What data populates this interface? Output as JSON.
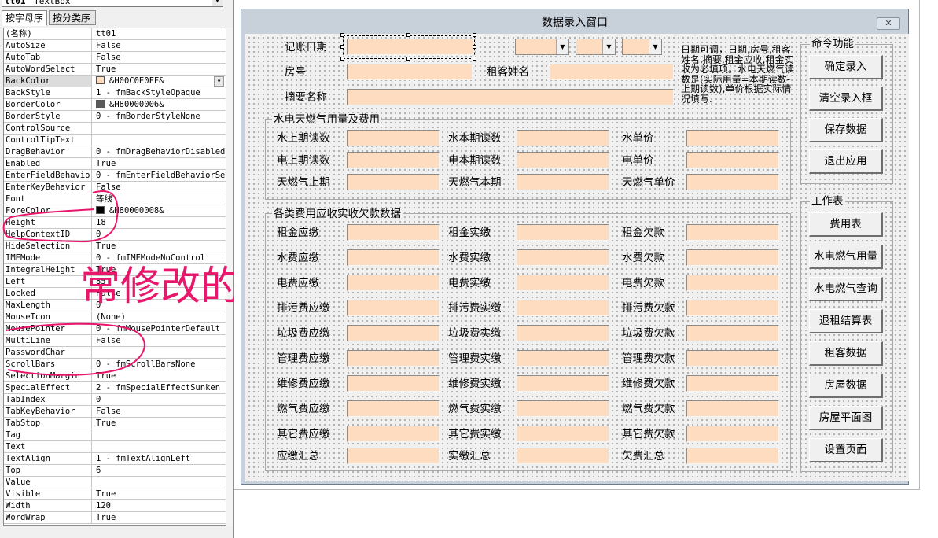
{
  "properties_window": {
    "object_name": "tt01",
    "object_type": "TextBox",
    "tabs": [
      "按字母序",
      "按分类序"
    ],
    "rows": [
      {
        "name": "(名称)",
        "value": "tt01"
      },
      {
        "name": "AutoSize",
        "value": "False"
      },
      {
        "name": "AutoTab",
        "value": "False"
      },
      {
        "name": "AutoWordSelect",
        "value": "True"
      },
      {
        "name": "BackColor",
        "value": "&H00C0E0FF&",
        "swatch": "#fddcc0",
        "selected": true
      },
      {
        "name": "BackStyle",
        "value": "1 - fmBackStyleOpaque"
      },
      {
        "name": "BorderColor",
        "value": "&H80000006&",
        "swatch": "#5a5a5a"
      },
      {
        "name": "BorderStyle",
        "value": "0 - fmBorderStyleNone"
      },
      {
        "name": "ControlSource",
        "value": ""
      },
      {
        "name": "ControlTipText",
        "value": ""
      },
      {
        "name": "DragBehavior",
        "value": "0 - fmDragBehaviorDisabled"
      },
      {
        "name": "Enabled",
        "value": "True"
      },
      {
        "name": "EnterFieldBehavior",
        "value": "0 - fmEnterFieldBehaviorSele"
      },
      {
        "name": "EnterKeyBehavior",
        "value": "False"
      },
      {
        "name": "Font",
        "value": "等线"
      },
      {
        "name": "ForeColor",
        "value": "&H80000008&",
        "swatch": "#000000"
      },
      {
        "name": "Height",
        "value": "18"
      },
      {
        "name": "HelpContextID",
        "value": "0"
      },
      {
        "name": "HideSelection",
        "value": "True"
      },
      {
        "name": "IMEMode",
        "value": "0 - fmIMEModeNoControl"
      },
      {
        "name": "IntegralHeight",
        "value": "True"
      },
      {
        "name": "Left",
        "value": "85"
      },
      {
        "name": "Locked",
        "value": "False"
      },
      {
        "name": "MaxLength",
        "value": "0"
      },
      {
        "name": "MouseIcon",
        "value": "(None)"
      },
      {
        "name": "MousePointer",
        "value": "0 - fmMousePointerDefault"
      },
      {
        "name": "MultiLine",
        "value": "False"
      },
      {
        "name": "PasswordChar",
        "value": ""
      },
      {
        "name": "ScrollBars",
        "value": "0 - fmScrollBarsNone"
      },
      {
        "name": "SelectionMargin",
        "value": "True"
      },
      {
        "name": "SpecialEffect",
        "value": "2 - fmSpecialEffectSunken"
      },
      {
        "name": "TabIndex",
        "value": "0"
      },
      {
        "name": "TabKeyBehavior",
        "value": "False"
      },
      {
        "name": "TabStop",
        "value": "True"
      },
      {
        "name": "Tag",
        "value": ""
      },
      {
        "name": "Text",
        "value": ""
      },
      {
        "name": "TextAlign",
        "value": "1 - fmTextAlignLeft"
      },
      {
        "name": "Top",
        "value": "6"
      },
      {
        "name": "Value",
        "value": ""
      },
      {
        "name": "Visible",
        "value": "True"
      },
      {
        "name": "Width",
        "value": "120"
      },
      {
        "name": "WordWrap",
        "value": "True"
      }
    ]
  },
  "annotation": {
    "text": "常修改的属性",
    "color": "#e8176b"
  },
  "form": {
    "title": "数据录入窗口",
    "close_glyph": "✕",
    "fields": {
      "date_label": "记账日期",
      "room_label": "房号",
      "tenant_label": "租客姓名",
      "summary_label": "摘要名称"
    },
    "note": "日期可调，日期,房号,租客姓名,摘要,租金应收,租金实收为必填项。水电天燃气读数是(实际用量=本期读数-上期读数),单价根据实际情况填写."
  },
  "utility_frame": {
    "title": "水电天燃气用量及费用",
    "rows": [
      [
        "水上期读数",
        "水本期读数",
        "水单价"
      ],
      [
        "电上期读数",
        "电本期读数",
        "电单价"
      ],
      [
        "天燃气上期",
        "天燃气本期",
        "天燃气单价"
      ]
    ]
  },
  "fees_frame": {
    "title": "各类费用应收实收欠款数据",
    "rows": [
      [
        "租金应缴",
        "租金实缴",
        "租金欠款"
      ],
      [
        "水费应缴",
        "水费实缴",
        "水费欠款"
      ],
      [
        "电费应缴",
        "电费实缴",
        "电费欠款"
      ],
      [
        "排污费应缴",
        "排污费实缴",
        "排污费欠款"
      ],
      [
        "垃圾费应缴",
        "垃圾费实缴",
        "垃圾费欠款"
      ],
      [
        "管理费应缴",
        "管理费实缴",
        "管理费欠款"
      ],
      [
        "维修费应缴",
        "维修费实缴",
        "维修费欠款"
      ],
      [
        "燃气费应缴",
        "燃气费实缴",
        "燃气费欠款"
      ],
      [
        "其它费应缴",
        "其它费实缴",
        "其它费欠款"
      ],
      [
        "应缴汇总",
        "实缴汇总",
        "欠费汇总"
      ]
    ]
  },
  "command_frame": {
    "title": "命令功能",
    "buttons": [
      "确定录入",
      "清空录入框",
      "保存数据",
      "退出应用"
    ]
  },
  "worksheet_frame": {
    "title": "工作表",
    "buttons": [
      "费用表",
      "水电燃气用量",
      "水电燃气查询",
      "退租结算表",
      "租客数据",
      "房屋数据",
      "房屋平面图",
      "设置页面"
    ]
  },
  "colors": {
    "textbox_fill": "#fddcc0",
    "canvas": "#f0f0f0",
    "annotation": "#e8176b"
  },
  "icons": {
    "dropdown": "▼",
    "close": "close-icon"
  }
}
